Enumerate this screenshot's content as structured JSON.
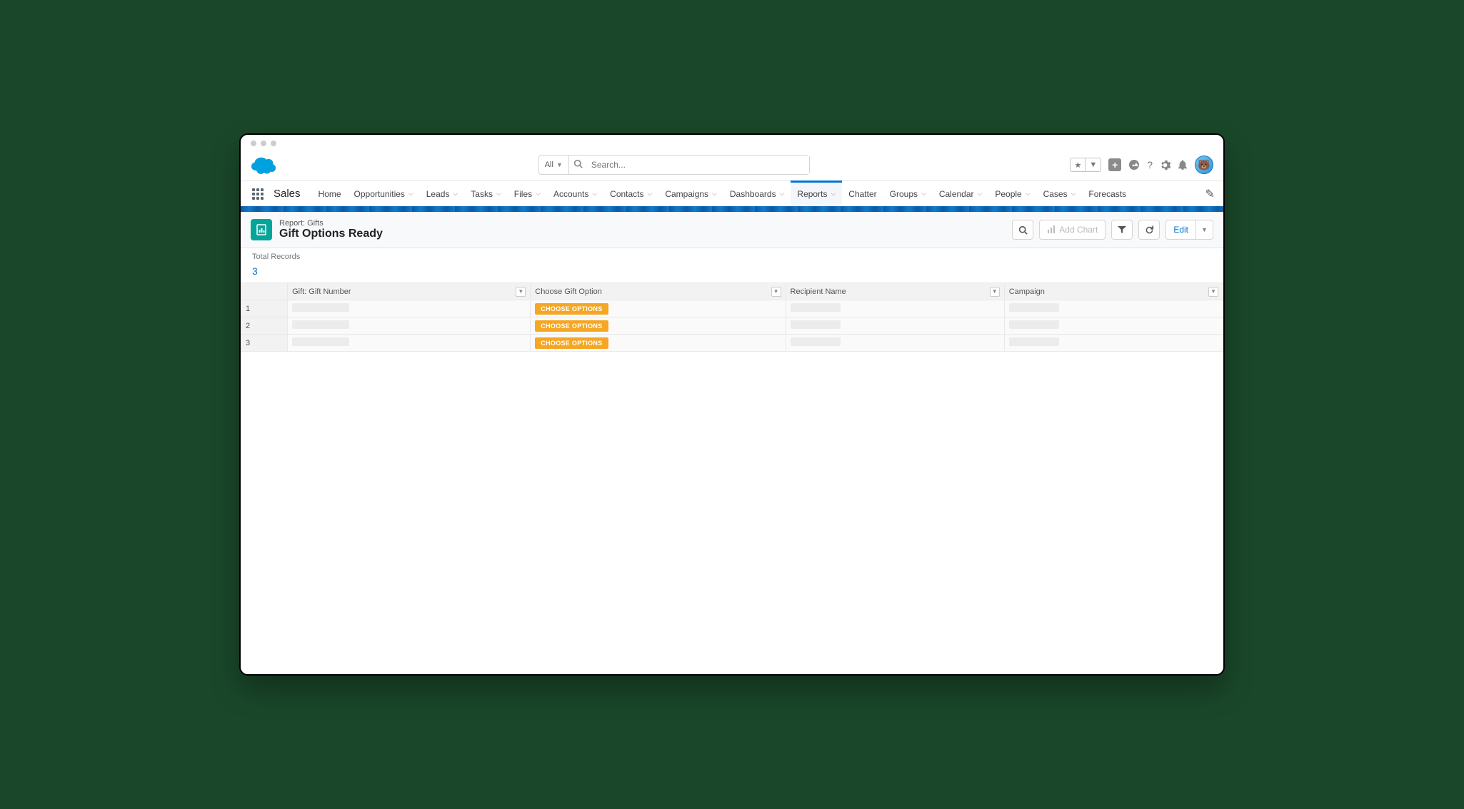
{
  "search": {
    "scope": "All",
    "placeholder": "Search..."
  },
  "appName": "Sales",
  "nav": {
    "items": [
      "Home",
      "Opportunities",
      "Leads",
      "Tasks",
      "Files",
      "Accounts",
      "Contacts",
      "Campaigns",
      "Dashboards",
      "Reports",
      "Chatter",
      "Groups",
      "Calendar",
      "People",
      "Cases",
      "Forecasts"
    ],
    "withChevron": [
      "Opportunities",
      "Leads",
      "Tasks",
      "Files",
      "Accounts",
      "Contacts",
      "Campaigns",
      "Dashboards",
      "Reports",
      "Groups",
      "Calendar",
      "People",
      "Cases"
    ],
    "active": "Reports"
  },
  "page": {
    "type": "Report: Gifts",
    "title": "Gift Options Ready",
    "actions": {
      "addChart": "Add Chart",
      "edit": "Edit"
    }
  },
  "summary": {
    "totalRecordsLabel": "Total Records",
    "totalRecords": "3"
  },
  "table": {
    "columns": [
      "Gift: Gift Number",
      "Choose Gift Option",
      "Recipient Name",
      "Campaign"
    ],
    "rows": [
      {
        "num": "1",
        "chooseLabel": "CHOOSE OPTIONS"
      },
      {
        "num": "2",
        "chooseLabel": "CHOOSE OPTIONS"
      },
      {
        "num": "3",
        "chooseLabel": "CHOOSE OPTIONS"
      }
    ]
  }
}
